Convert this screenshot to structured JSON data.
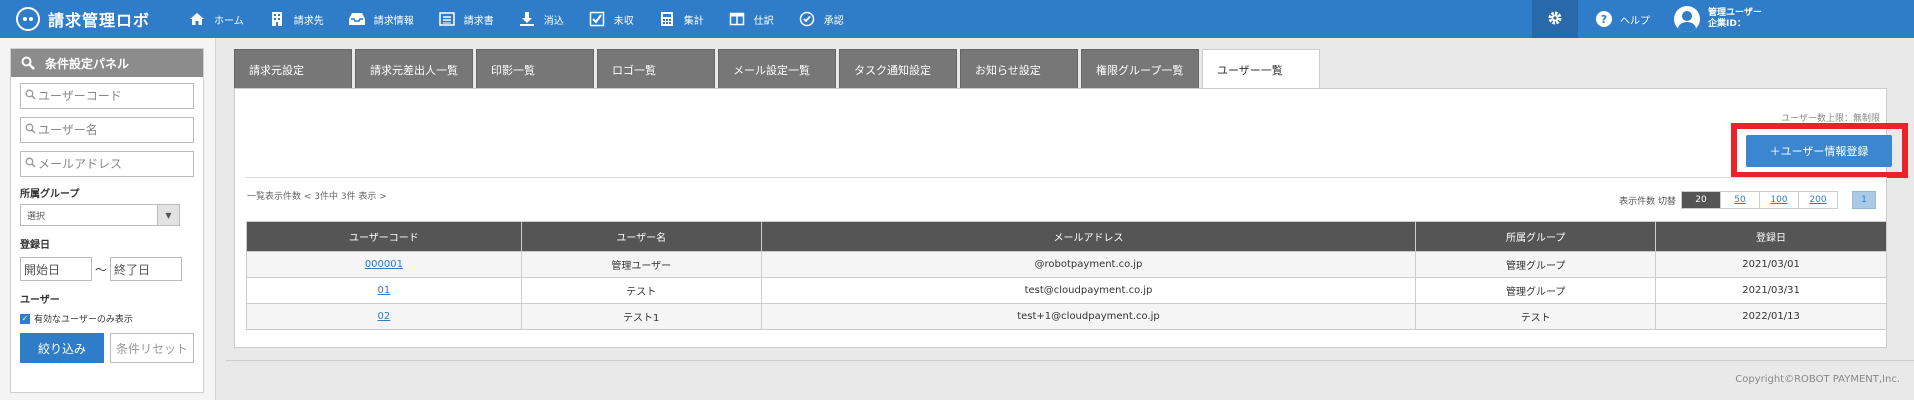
{
  "app": {
    "title": "請求管理ロボ"
  },
  "nav": [
    {
      "label": "ホーム",
      "icon": "home-icon"
    },
    {
      "label": "請求先",
      "icon": "building-icon"
    },
    {
      "label": "請求情報",
      "icon": "inbox-icon"
    },
    {
      "label": "請求書",
      "icon": "list-icon"
    },
    {
      "label": "消込",
      "icon": "download-icon"
    },
    {
      "label": "未収",
      "icon": "checkbox-icon"
    },
    {
      "label": "集計",
      "icon": "calculator-icon"
    },
    {
      "label": "仕訳",
      "icon": "ledger-icon"
    },
    {
      "label": "承認",
      "icon": "check-circle-icon"
    }
  ],
  "header_right": {
    "help_label": "ヘルプ",
    "user_name": "管理ユーザー",
    "company_label": "企業ID："
  },
  "sidebar": {
    "title": "条件設定パネル",
    "user_code_placeholder": "ユーザーコード",
    "user_name_placeholder": "ユーザー名",
    "email_placeholder": "メールアドレス",
    "group_label": "所属グループ",
    "group_select_value": "選択",
    "date_label": "登録日",
    "date_start": "開始日",
    "date_tilde": "〜",
    "date_end": "終了日",
    "user_section_label": "ユーザー",
    "active_only_label": "有効なユーザーのみ表示",
    "active_only_checked": true,
    "filter_button": "絞り込み",
    "reset_button": "条件リセット"
  },
  "tabs": [
    {
      "label": "請求元設定",
      "active": false
    },
    {
      "label": "請求元差出人一覧",
      "active": false
    },
    {
      "label": "印影一覧",
      "active": false
    },
    {
      "label": "ロゴ一覧",
      "active": false
    },
    {
      "label": "メール設定一覧",
      "active": false
    },
    {
      "label": "タスク通知設定",
      "active": false
    },
    {
      "label": "お知らせ設定",
      "active": false
    },
    {
      "label": "権限グループ一覧",
      "active": false
    },
    {
      "label": "ユーザー一覧",
      "active": true
    }
  ],
  "main": {
    "user_limit": "ユーザー数上限：無制限",
    "add_button": "＋ユーザー情報登録",
    "list_info": "一覧表示件数 < 3件中 3件 表示 >",
    "pager_label": "表示件数 切替",
    "page_sizes": [
      "20",
      "50",
      "100",
      "200"
    ],
    "selected_page_size": "20",
    "current_page": "1",
    "highlight_color": "#e8242a"
  },
  "table": {
    "headers": [
      "ユーザーコード",
      "ユーザー名",
      "メールアドレス",
      "所属グループ",
      "登録日"
    ],
    "rows": [
      {
        "code": "000001",
        "name": "管理ユーザー",
        "email": "@robotpayment.co.jp",
        "group": "管理グループ",
        "date": "2021/03/01"
      },
      {
        "code": "01",
        "name": "テスト",
        "email": "test@cloudpayment.co.jp",
        "group": "管理グループ",
        "date": "2021/03/31"
      },
      {
        "code": "02",
        "name": "テスト1",
        "email": "test+1@cloudpayment.co.jp",
        "group": "テスト",
        "date": "2022/01/13"
      }
    ]
  },
  "footer": {
    "copyright": "Copyright©ROBOT PAYMENT,Inc."
  }
}
